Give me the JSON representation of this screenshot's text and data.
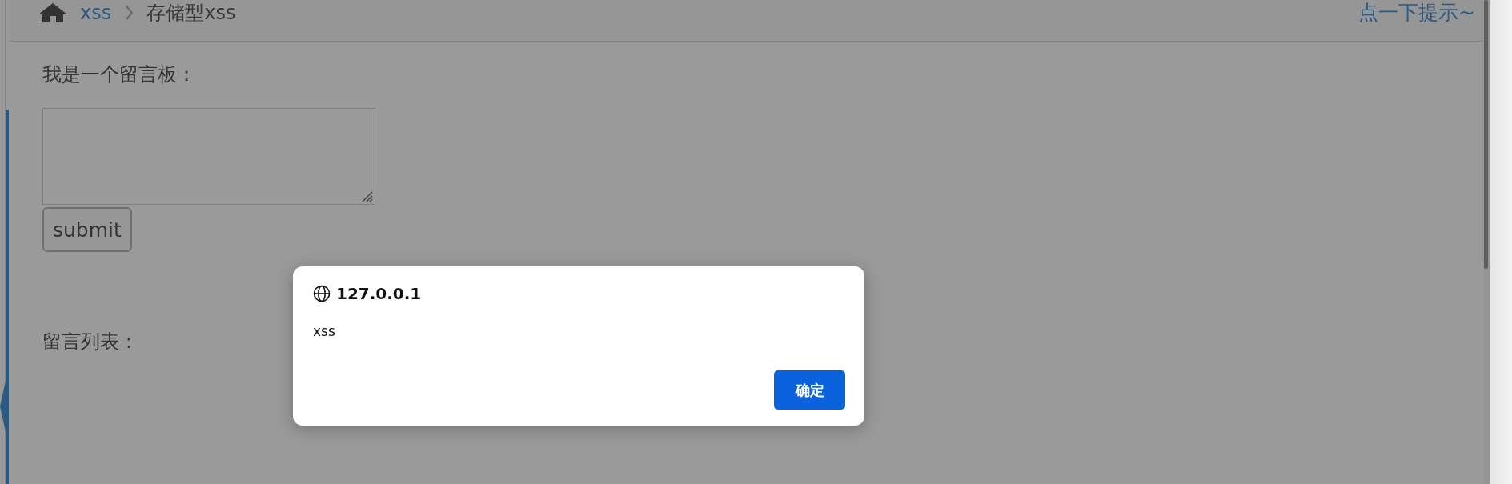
{
  "breadcrumb": {
    "items": [
      {
        "label": "xss",
        "kind": "link"
      },
      {
        "label": "存储型xss",
        "kind": "current"
      }
    ],
    "hint_link": "点一下提示~"
  },
  "form": {
    "label": "我是一个留言板：",
    "submit": "submit"
  },
  "list_heading": "留言列表：",
  "dialog": {
    "origin": "127.0.0.1",
    "message": "xss",
    "ok_button": "确定"
  }
}
